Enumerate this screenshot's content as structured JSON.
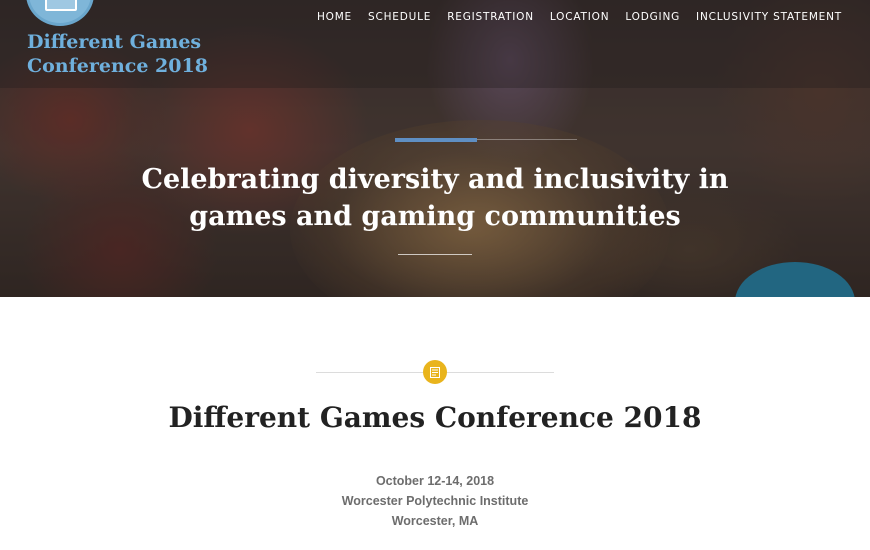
{
  "site": {
    "title_line1": "Different Games",
    "title_line2": "Conference 2018",
    "logo_icon": "conference-logo-icon"
  },
  "nav": {
    "items": [
      {
        "label": "HOME"
      },
      {
        "label": "SCHEDULE"
      },
      {
        "label": "REGISTRATION"
      },
      {
        "label": "LOCATION"
      },
      {
        "label": "LODGING"
      },
      {
        "label": "INCLUSIVITY STATEMENT"
      }
    ]
  },
  "hero": {
    "headline_line1": "Celebrating diversity and inclusivity in",
    "headline_line2": "games and gaming communities"
  },
  "post": {
    "icon": "document-icon",
    "title": "Different Games Conference 2018",
    "date": "October 12-14, 2018",
    "venue": "Worcester Polytechnic Institute",
    "city": "Worcester, MA"
  },
  "colors": {
    "site_title": "#6fb0dd",
    "accent_blue": "#5f8fc3",
    "badge_yellow": "#e9b41c",
    "title_text": "#222222",
    "details_text": "#6d6d6d"
  }
}
